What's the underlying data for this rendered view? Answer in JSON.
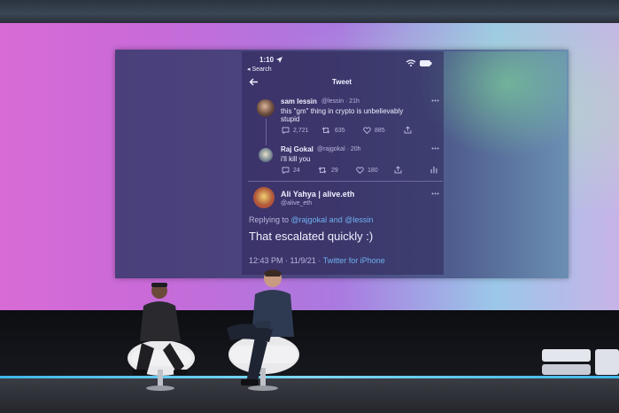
{
  "slide": {
    "status_bar": {
      "time": "1:10",
      "back_link": "◂ Search"
    },
    "nav_title": "Tweet",
    "tweets": [
      {
        "name": "sam lessin",
        "handle": "@lessin · 21h",
        "text_line1": "this \"gm\" thing in crypto is unbelievably",
        "text_line2": "stupid",
        "replies": "2,721",
        "retweets": "635",
        "likes": "885"
      },
      {
        "name": "Raj Gokal",
        "handle": "@rajgokal · 20h",
        "text_line1": "i'll kill you",
        "replies": "24",
        "retweets": "29",
        "likes": "180"
      }
    ],
    "main_tweet": {
      "name": "Ali Yahya | alive.eth",
      "handle": "@alive_eth",
      "replying_prefix": "Replying to ",
      "replying_to": "@rajgokal and @lessin",
      "text": "That escalated quickly :)",
      "timestamp": "12:43 PM · 11/9/21 · ",
      "source": "Twitter for iPhone"
    }
  },
  "colors": {
    "backdrop_left": "#d86bd6",
    "backdrop_right": "#9bc7e8",
    "screen": "#4a3f7a",
    "link_blue": "#6fb1f0",
    "stage_light": "#3fb6e8"
  }
}
